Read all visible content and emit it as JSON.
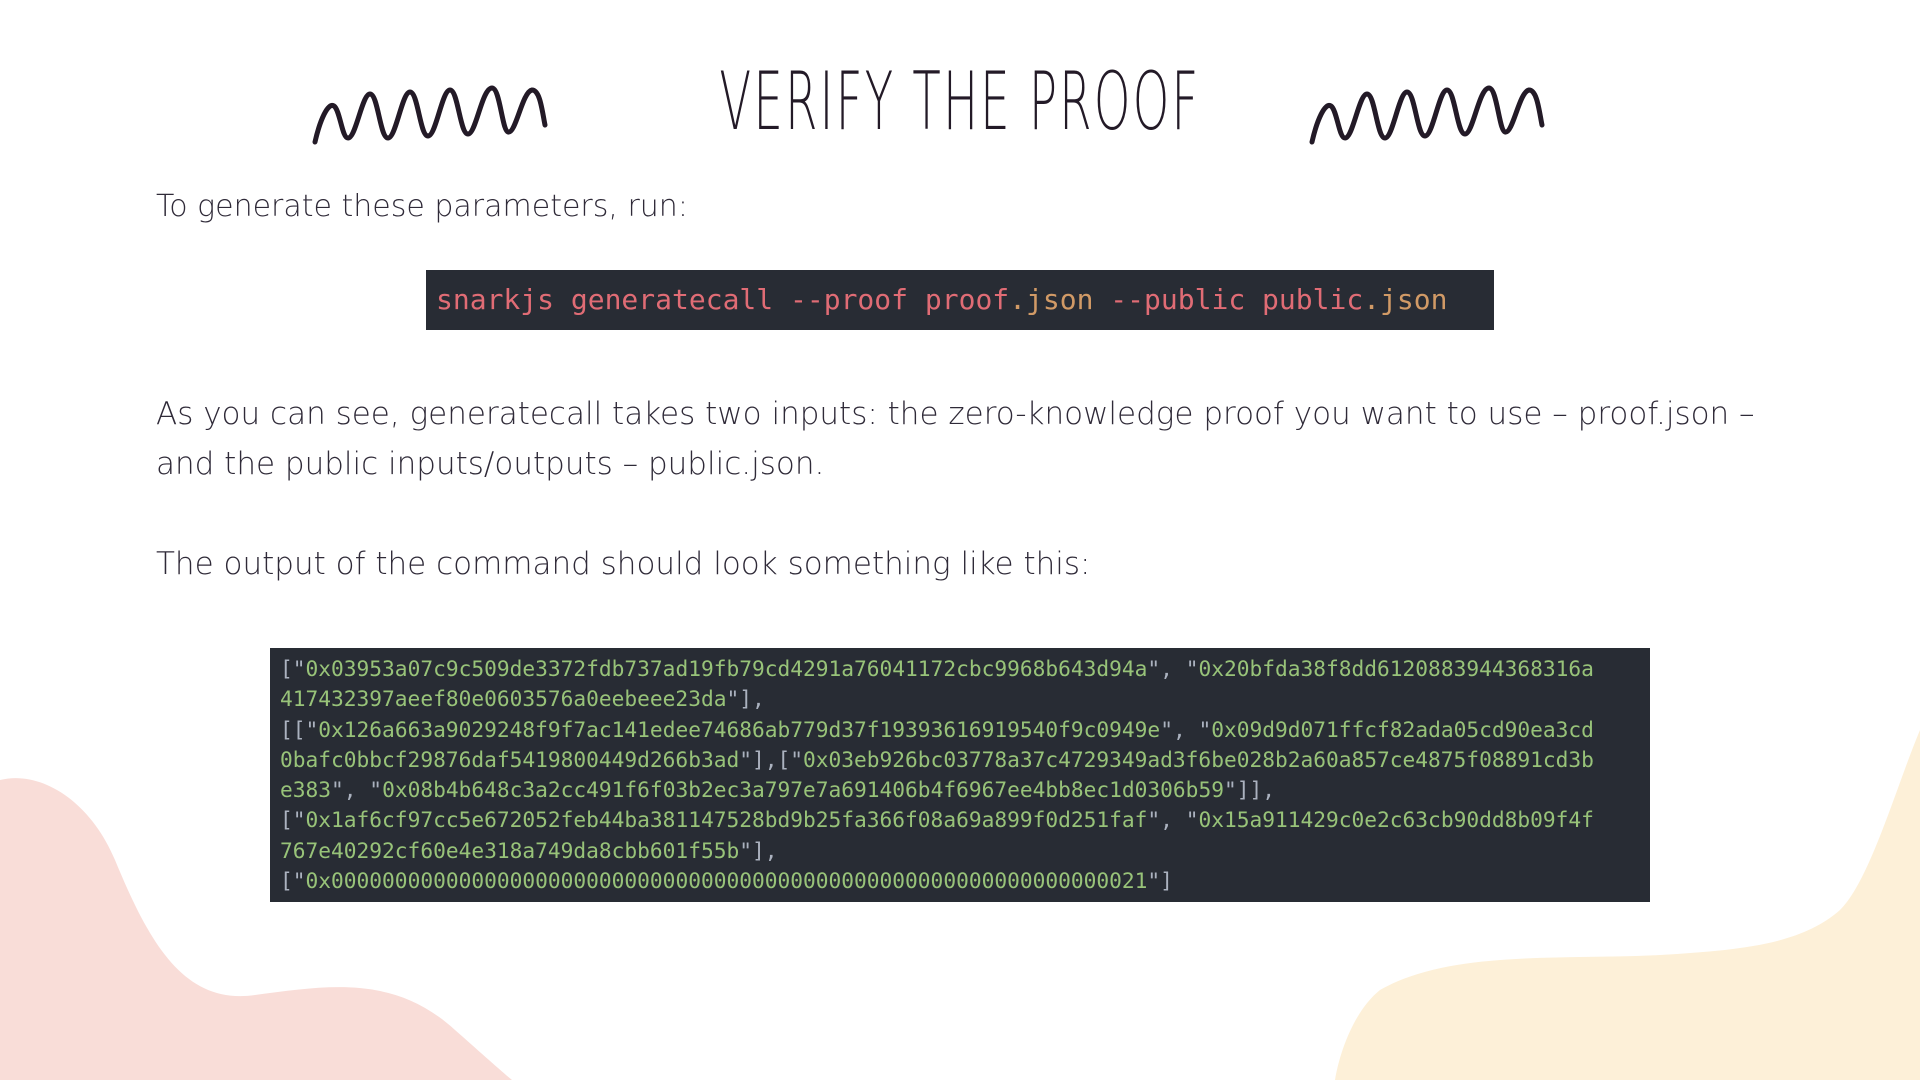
{
  "slide": {
    "title": "VERIFY THE PROOF",
    "intro": "To generate these parameters, run:",
    "command": {
      "tokens": [
        "snarkjs generatecall --proof proof",
        ".json",
        " --public public",
        ".json"
      ],
      "colors": {
        "text": "#e06c75",
        "extension": "#d19a66",
        "background": "#282c34"
      }
    },
    "explanation": "As you can see, generatecall takes two inputs: the zero-knowledge proof you want to use – proof.json – and the public inputs/outputs – public.json.",
    "output_intro": "The output of the command should look something like this:",
    "output_lines": [
      [
        [
          "pun",
          "[\""
        ],
        [
          "str",
          "0x03953a07c9c509de3372fdb737ad19fb79cd4291a76041172cbc9968b643d94a"
        ],
        [
          "pun",
          "\", \""
        ],
        [
          "str",
          "0x20bfda38f8dd6120883944368316a"
        ]
      ],
      [
        [
          "str",
          "417432397aeef80e0603576a0eebeee23da"
        ],
        [
          "pun",
          "\"],"
        ]
      ],
      [
        [
          "pun",
          "[[\""
        ],
        [
          "str",
          "0x126a663a9029248f9f7ac141edee74686ab779d37f19393616919540f9c0949e"
        ],
        [
          "pun",
          "\", \""
        ],
        [
          "str",
          "0x09d9d071ffcf82ada05cd90ea3cd"
        ]
      ],
      [
        [
          "str",
          "0bafc0bbcf29876daf5419800449d266b3ad"
        ],
        [
          "pun",
          "\"],[\""
        ],
        [
          "str",
          "0x03eb926bc03778a37c4729349ad3f6be028b2a60a857ce4875f08891cd3b"
        ]
      ],
      [
        [
          "str",
          "e383"
        ],
        [
          "pun",
          "\", \""
        ],
        [
          "str",
          "0x08b4b648c3a2cc491f6f03b2ec3a797e7a691406b4f6967ee4bb8ec1d0306b59"
        ],
        [
          "pun",
          "\"]],"
        ]
      ],
      [
        [
          "pun",
          "[\""
        ],
        [
          "str",
          "0x1af6cf97cc5e672052feb44ba381147528bd9b25fa366f08a69a899f0d251faf"
        ],
        [
          "pun",
          "\", \""
        ],
        [
          "str",
          "0x15a911429c0e2c63cb90dd8b09f4f"
        ]
      ],
      [
        [
          "str",
          "767e40292cf60e4e318a749da8cbb601f55b"
        ],
        [
          "pun",
          "\"],"
        ]
      ],
      [
        [
          "pun",
          "[\""
        ],
        [
          "str",
          "0x0000000000000000000000000000000000000000000000000000000000000021"
        ],
        [
          "pun",
          "\"]"
        ]
      ]
    ],
    "colors": {
      "ink": "#231a27",
      "body_text": "#2f2a38",
      "code_string": "#98c379",
      "code_punct": "#abb2bf",
      "blob_pink": "#f9ddd8",
      "blob_cream": "#fdf0d8"
    }
  }
}
